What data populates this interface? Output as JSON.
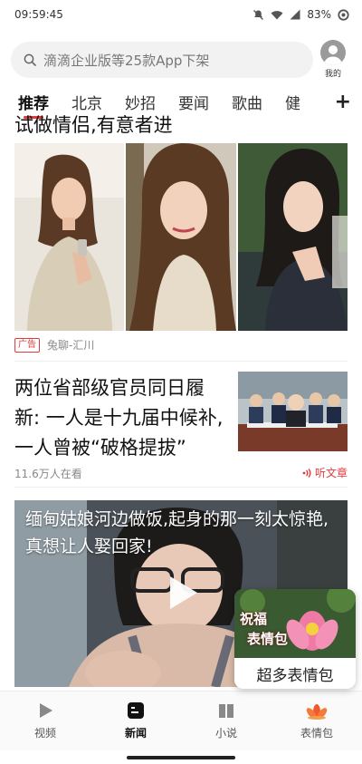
{
  "status": {
    "time": "09:59:45",
    "battery": "83%"
  },
  "search": {
    "placeholder": "滴滴企业版等25款App下架"
  },
  "profile": {
    "label": "我的"
  },
  "tabs": [
    {
      "label": "推荐",
      "active": true
    },
    {
      "label": "北京"
    },
    {
      "label": "妙招"
    },
    {
      "label": "要闻"
    },
    {
      "label": "歌曲"
    },
    {
      "label": "健"
    }
  ],
  "tabs_more": "+",
  "ad": {
    "title_partial": "试做情侣,有意者进",
    "tag": "广告",
    "source": "兔聊-汇川"
  },
  "news": {
    "title": "两位省部级官员同日履新: 一人是十九届中候补,一人曾被“破格提拔”",
    "meta": "11.6万人在看",
    "listen_label": "听文章"
  },
  "video": {
    "title": "缅甸姑娘河边做饭,起身的那一刻太惊艳,真想让人娶回家!"
  },
  "float_card": {
    "img_text_1": "祝福",
    "img_text_2": "表情包",
    "label": "超多表情包"
  },
  "bottom_nav": [
    {
      "label": "视频",
      "icon": "play-icon"
    },
    {
      "label": "新闻",
      "icon": "news-icon",
      "active": true
    },
    {
      "label": "小说",
      "icon": "book-icon"
    },
    {
      "label": "表情包",
      "icon": "lotus-icon"
    }
  ],
  "colors": {
    "accent": "#e4393c",
    "text": "#111111",
    "muted": "#888888"
  }
}
